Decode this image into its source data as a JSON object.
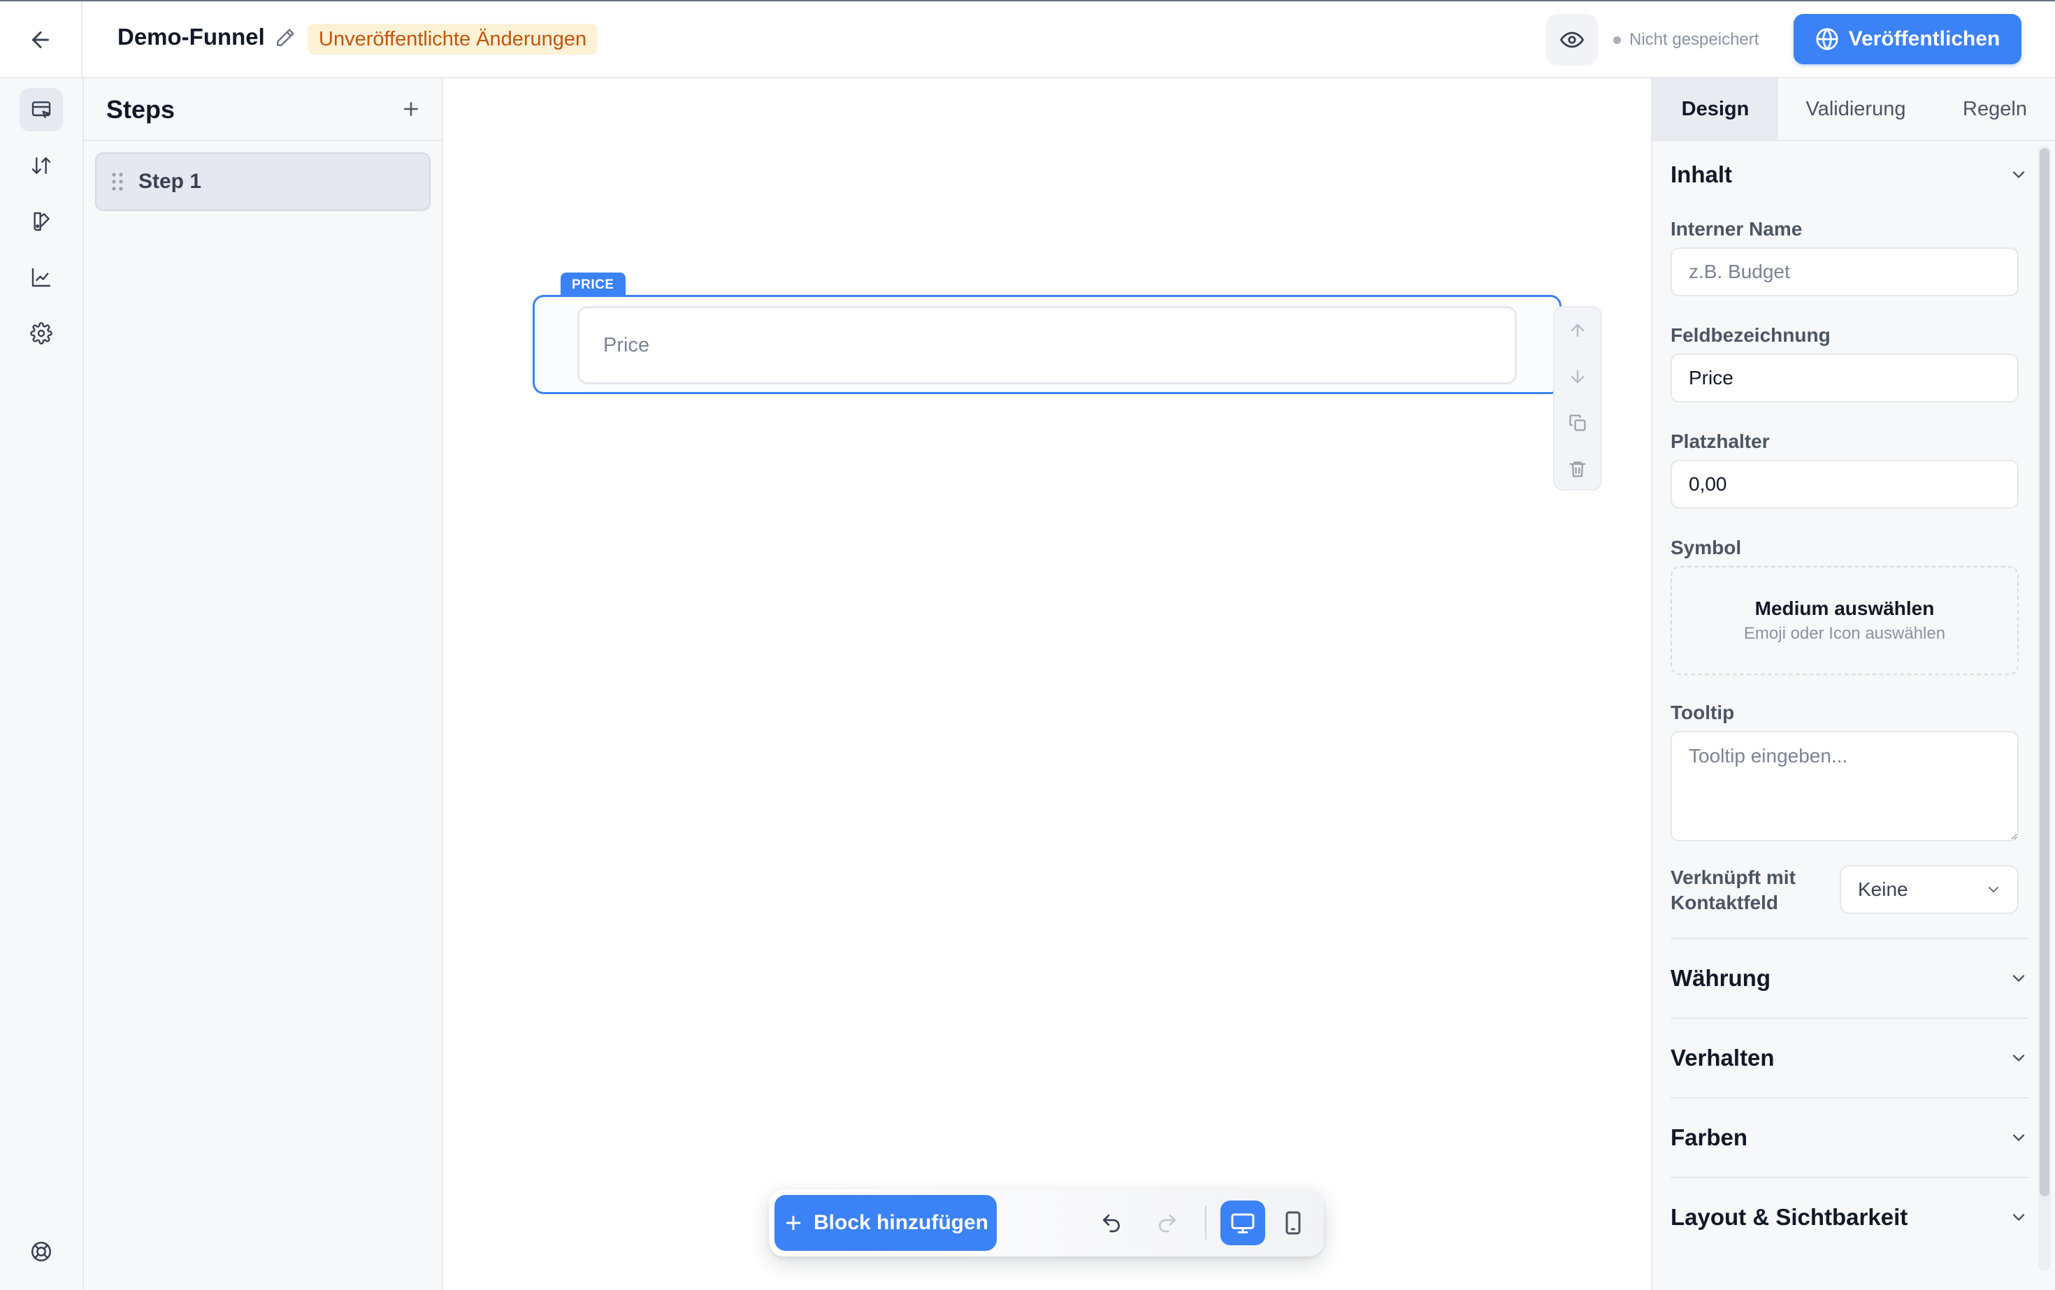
{
  "header": {
    "funnel_title": "Demo-Funnel",
    "unsaved_badge": "Unveröffentlichte Änderungen",
    "save_status": "Nicht gespeichert",
    "publish_label": "Veröffentlichen"
  },
  "rail": {
    "items": [
      "editor-icon",
      "sort-icon",
      "theme-icon",
      "analytics-icon",
      "settings-icon"
    ],
    "footer": "help-icon"
  },
  "steps": {
    "title": "Steps",
    "items": [
      {
        "label": "Step 1"
      }
    ]
  },
  "canvas": {
    "block_tag": "PRICE",
    "block_placeholder": "Price",
    "toolbar": [
      "arrow-up-icon",
      "arrow-down-icon",
      "duplicate-icon",
      "trash-icon"
    ],
    "add_block_label": "Block hinzufügen",
    "view_mode": "desktop"
  },
  "properties": {
    "tabs": [
      {
        "label": "Design",
        "active": true
      },
      {
        "label": "Validierung",
        "active": false
      },
      {
        "label": "Regeln",
        "active": false
      }
    ],
    "inhalt": {
      "title": "Inhalt",
      "internal_name_label": "Interner Name",
      "internal_name_placeholder": "z.B. Budget",
      "field_label_label": "Feldbezeichnung",
      "field_label_value": "Price",
      "placeholder_label": "Platzhalter",
      "placeholder_value": "0,00",
      "symbol_label": "Symbol",
      "media_title": "Medium auswählen",
      "media_sub": "Emoji oder Icon auswählen",
      "tooltip_label": "Tooltip",
      "tooltip_placeholder": "Tooltip eingeben...",
      "linked_label": "Verknüpft mit Kontaktfeld",
      "linked_value": "Keine"
    },
    "sections": [
      "Währung",
      "Verhalten",
      "Farben",
      "Layout & Sichtbarkeit"
    ]
  },
  "colors": {
    "accent": "#3b82f6",
    "badge_bg": "#fdf1d6",
    "badge_text": "#c2560c"
  }
}
